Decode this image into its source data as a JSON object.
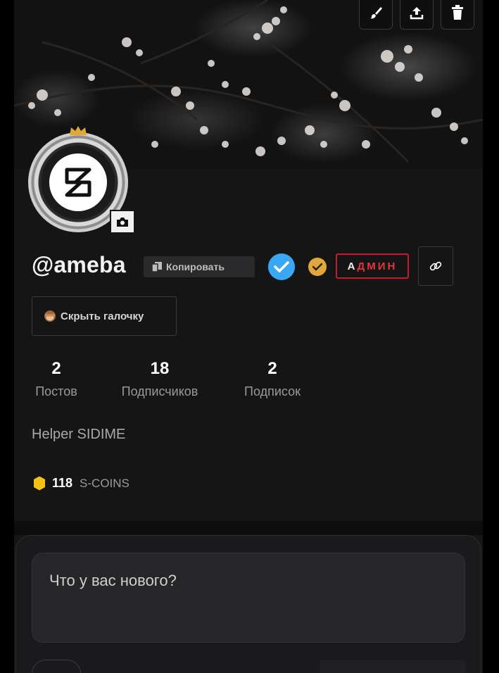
{
  "profile": {
    "username": "@ameba",
    "copy_label": "Копировать",
    "admin_badge_a": "А",
    "admin_badge_d": "Д",
    "admin_badge_min": "МИН",
    "hide_check_label": "Скрыть галочку",
    "bio": "Helper SIDIME"
  },
  "stats": [
    {
      "value": "2",
      "label": "Постов"
    },
    {
      "value": "18",
      "label": "Подписчиков"
    },
    {
      "value": "2",
      "label": "Подписок"
    }
  ],
  "coins": {
    "value": "118",
    "unit": "S-COINS"
  },
  "compose": {
    "placeholder": "Что у вас нового?"
  },
  "colors": {
    "verified": "#3aa7f5",
    "gold": "#e0a83a",
    "admin_red": "#c21d2e",
    "coin": "#f2c316"
  },
  "icons": [
    "brush-icon",
    "upload-icon",
    "trash-icon",
    "crown-icon",
    "camera-icon",
    "copy-icon",
    "verified-check-icon",
    "gold-check-icon",
    "link-icon",
    "monkey-icon",
    "coin-icon"
  ]
}
